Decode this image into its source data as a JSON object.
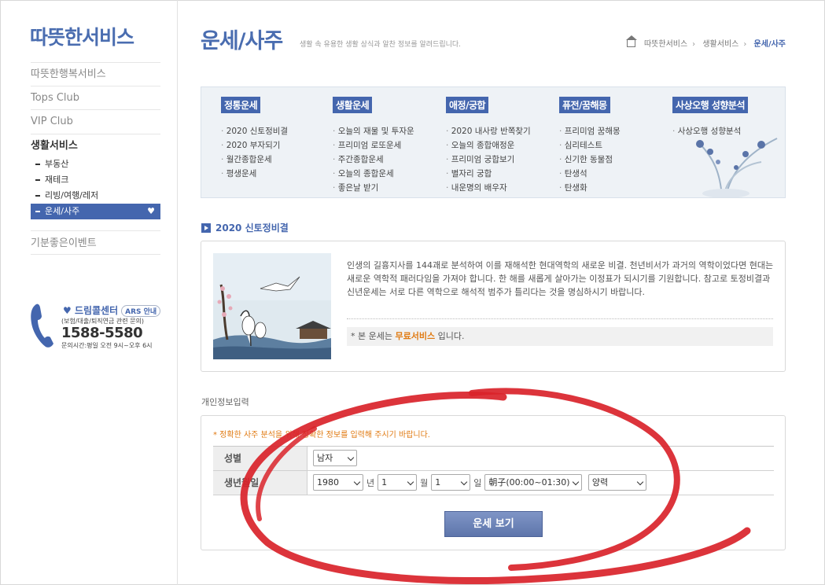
{
  "brand": "따뜻한서비스",
  "sidebar": {
    "items": [
      {
        "label": "따뜻한행복서비스"
      },
      {
        "label": "Tops Club"
      },
      {
        "label": "VIP Club"
      }
    ],
    "group": {
      "title": "생활서비스",
      "subs": [
        {
          "label": "부동산"
        },
        {
          "label": "재테크"
        },
        {
          "label": "리빙/여행/레저"
        },
        {
          "label": "운세/사주"
        }
      ]
    },
    "event": "기분좋은이벤트"
  },
  "callcenter": {
    "title": "드림콜센터",
    "ars": "ARS 안내",
    "sub": "(보험/대출/퇴직연금 관련 문의)",
    "number": "1588-5580",
    "hours": "문의시간:평일 오전 9시~오후 6시"
  },
  "header": {
    "title": "운세/사주",
    "desc": "생활 속 유용한 생활 상식과 알찬 정보를 알려드립니다.",
    "breadcrumb": [
      "따뜻한서비스",
      "생활서비스",
      "운세/사주"
    ]
  },
  "menu": {
    "columns": [
      {
        "title": "정통운세",
        "items": [
          "2020 신토정비결",
          "2020 부자되기",
          "월간종합운세",
          "평생운세"
        ]
      },
      {
        "title": "생활운세",
        "items": [
          "오늘의 재물 및 투자운",
          "프리미엄 로또운세",
          "주간종합운세",
          "오늘의 종합운세",
          "좋은날 받기"
        ]
      },
      {
        "title": "애정/궁합",
        "items": [
          "2020 내사랑 반쪽찾기",
          "오늘의 종합애정운",
          "프리미엄 궁합보기",
          "별자리 궁합",
          "내운명의 배우자"
        ]
      },
      {
        "title": "퓨전/꿈해몽",
        "items": [
          "프리미엄 꿈해몽",
          "심리테스트",
          "신기한 동물점",
          "탄생석",
          "탄생화"
        ]
      },
      {
        "title": "사상오행 성향분석",
        "items": [
          "사상오행 성향분석"
        ]
      }
    ]
  },
  "section": {
    "title": "2020 신토정비결",
    "intro": "인생의 길흉지사를 144괘로 분석하여 이를 재해석한 현대역학의 새로운 비결. 천년비서가 과거의 역학이었다면 현대는 새로운 역학적 패러다임을 가져야 합니다. 한 해를 새롭게 살아가는 이정표가 되시기를 기원합니다. 참고로 토정비결과 신년운세는 서로 다른 역학으로 해석적 범주가 틀리다는 것을 명심하시기 바랍니다.",
    "note_prefix": "* 본 운세는",
    "note_highlight": "무료서비스",
    "note_suffix": "입니다."
  },
  "form": {
    "label": "개인정보입력",
    "warning": "* 정확한 사주 분석을 위해 정확한 정보를 입력해 주시기 바랍니다.",
    "gender_label": "성별",
    "gender_value": "남자",
    "birth_label": "생년월일",
    "year": "1980",
    "year_unit": "년",
    "month": "1",
    "month_unit": "월",
    "day": "1",
    "day_unit": "일",
    "hour": "朝子(00:00~01:30)",
    "calendar": "양력",
    "submit": "운세 보기"
  }
}
